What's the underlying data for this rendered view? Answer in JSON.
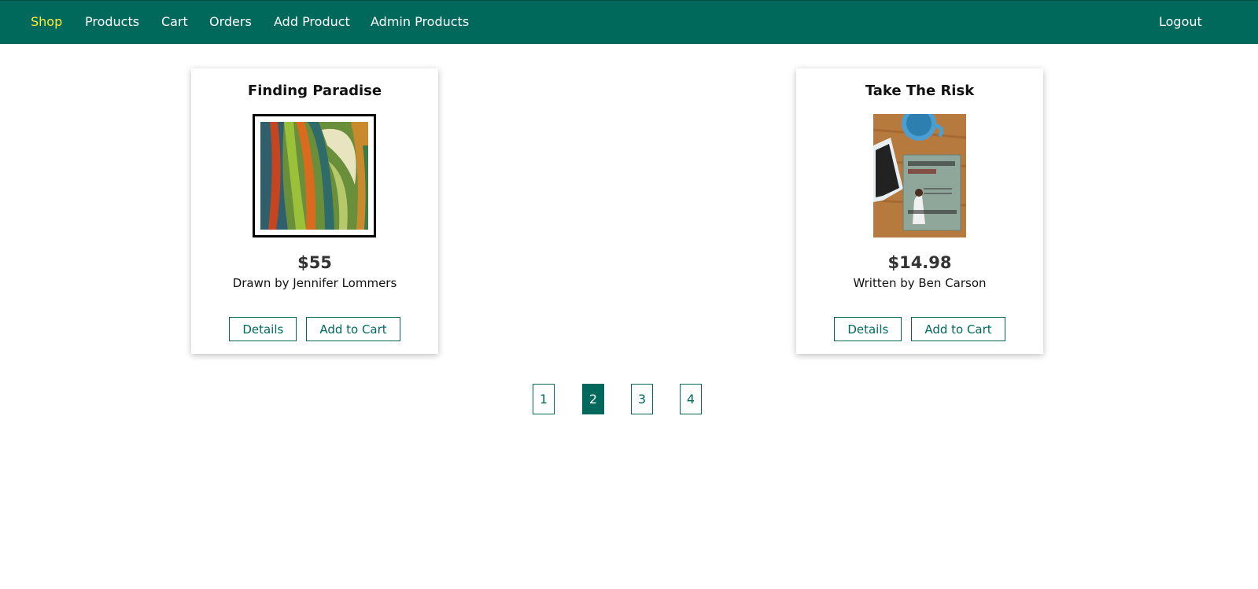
{
  "nav": {
    "items": [
      {
        "label": "Shop",
        "active": true
      },
      {
        "label": "Products",
        "active": false
      },
      {
        "label": "Cart",
        "active": false
      },
      {
        "label": "Orders",
        "active": false
      },
      {
        "label": "Add Product",
        "active": false
      },
      {
        "label": "Admin Products",
        "active": false
      }
    ],
    "logout_label": "Logout",
    "active_color": "#ffeb3b",
    "background_color": "#00695c"
  },
  "products": [
    {
      "title": "Finding Paradise",
      "price": "$55",
      "description": "Drawn by Jennifer Lommers",
      "image": "abstract-painting",
      "details_label": "Details",
      "add_to_cart_label": "Add to Cart"
    },
    {
      "title": "Take The Risk",
      "price": "$14.98",
      "description": "Written by Ben Carson",
      "image": "book-cover-photo",
      "details_label": "Details",
      "add_to_cart_label": "Add to Cart"
    }
  ],
  "pagination": {
    "pages": [
      "1",
      "2",
      "3",
      "4"
    ],
    "current": "2"
  }
}
